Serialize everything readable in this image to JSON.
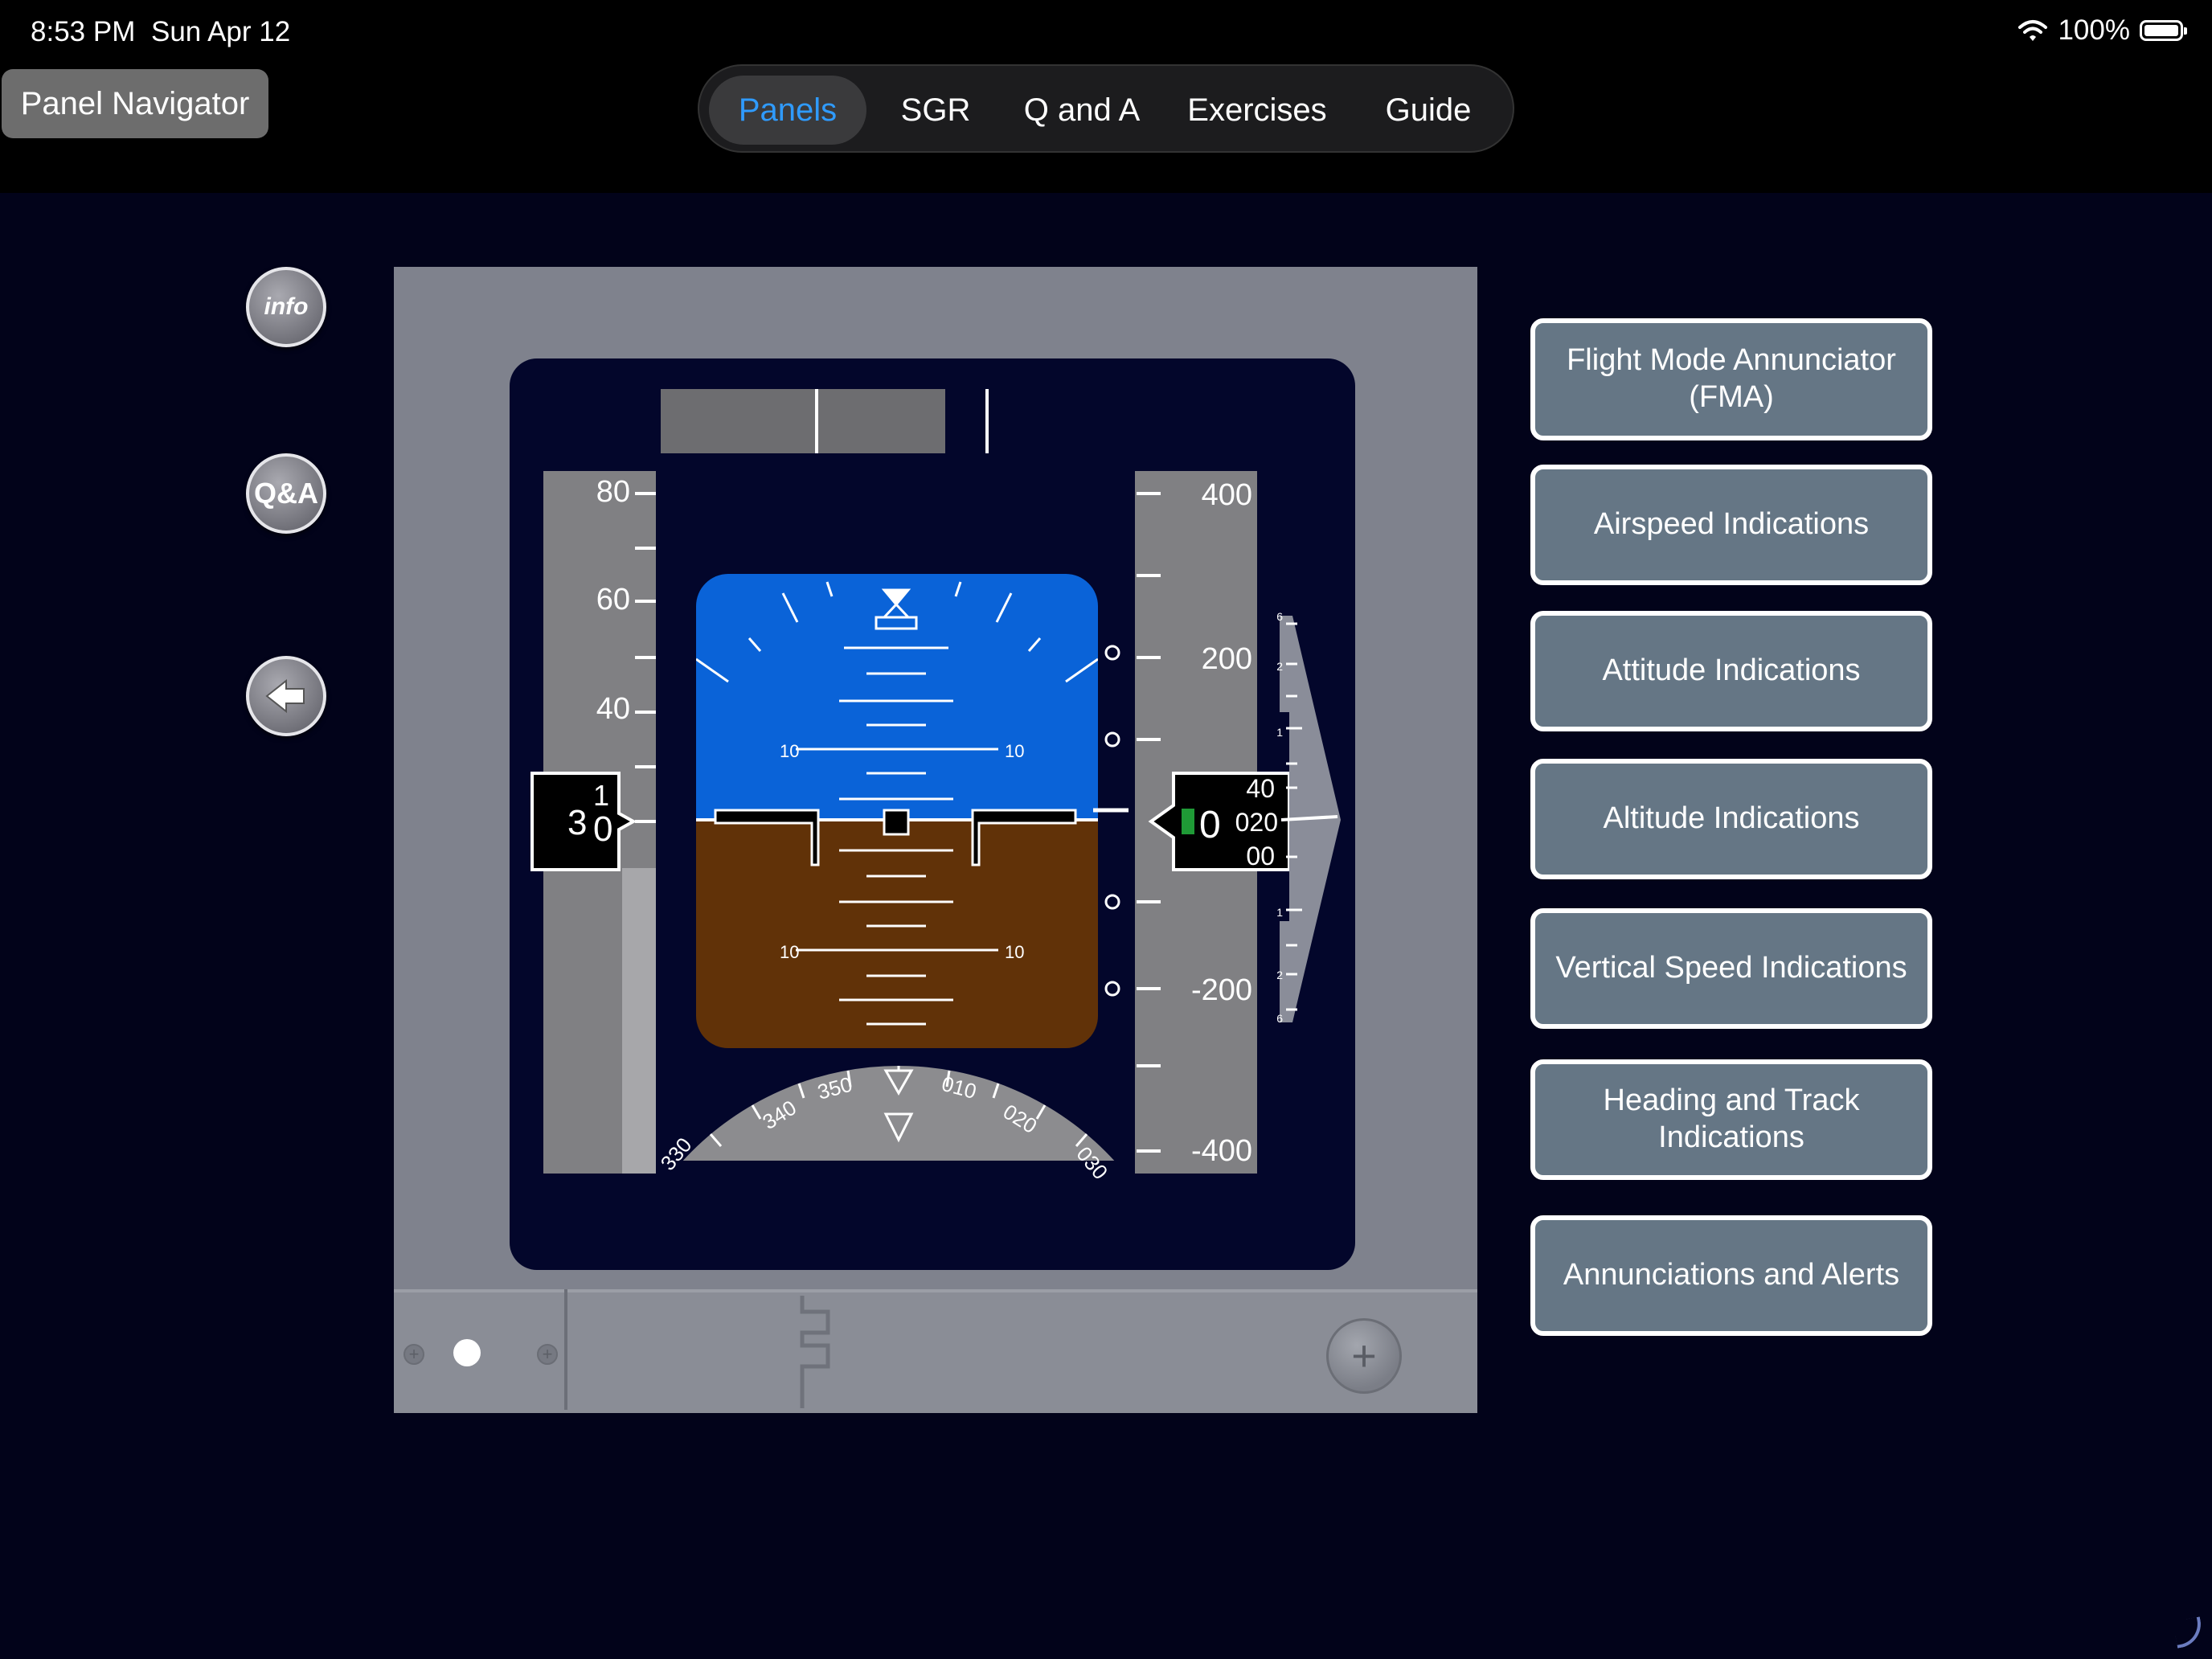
{
  "status_bar": {
    "time": "8:53 PM",
    "date": "Sun Apr 12",
    "battery": "100%"
  },
  "nav": {
    "panel_navigator": "Panel Navigator"
  },
  "tabs": [
    {
      "label": "Panels",
      "selected": true
    },
    {
      "label": "SGR"
    },
    {
      "label": "Q and A"
    },
    {
      "label": "Exercises"
    },
    {
      "label": "Guide"
    }
  ],
  "side_buttons": {
    "info": "info",
    "qa": "Q&A"
  },
  "pfd": {
    "speed_ticks": [
      "80",
      "60",
      "40"
    ],
    "speed_readout_digit": "3",
    "speed_drum": [
      "1",
      "0"
    ],
    "pitch_labels": [
      "10",
      "10",
      "10",
      "10"
    ],
    "vs_labels": [
      "400",
      "200",
      "-200",
      "-400"
    ],
    "altitude_readout_big": "0",
    "altitude_drum": [
      "40",
      "020",
      "00"
    ],
    "heading_labels": [
      "330",
      "340",
      "350",
      "010",
      "020",
      "030"
    ],
    "vs_scale_labels": [
      "6",
      "2",
      "1",
      "1",
      "2",
      "6"
    ]
  },
  "menu": {
    "fma": "Flight Mode Annunciator (FMA)",
    "airspeed": "Airspeed Indications",
    "attitude": "Attitude Indications",
    "altitude": "Altitude Indications",
    "vertical_speed": "Vertical Speed Indications",
    "heading": "Heading and Track Indications",
    "alerts": "Annunciations and Alerts"
  },
  "colors": {
    "sky": "#0a63d8",
    "ground": "#613208",
    "tab_selected": "#2f9bff",
    "button_fill": "#657685",
    "background": "#02031a"
  },
  "icons": [
    "wifi-icon",
    "battery-icon",
    "back-arrow-icon",
    "plus-icon"
  ]
}
